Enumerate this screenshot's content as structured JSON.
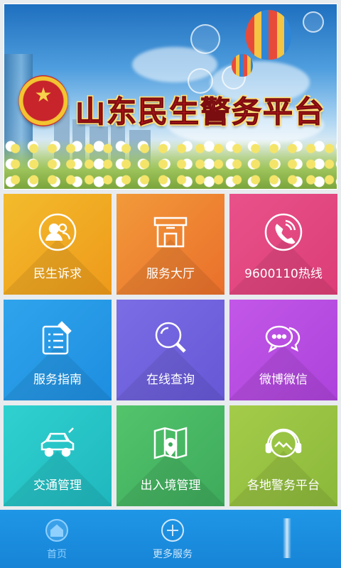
{
  "banner": {
    "title": "山东民生警务平台"
  },
  "tiles": [
    {
      "label": "民生诉求",
      "icon": "people-icon",
      "color_from": "#f3bb2c",
      "color_to": "#ee9a1b"
    },
    {
      "label": "服务大厅",
      "icon": "storefront-icon",
      "color_from": "#f29a3a",
      "color_to": "#ea6f2b"
    },
    {
      "label": "9600110热线",
      "icon": "phone-icon",
      "color_from": "#e9518a",
      "color_to": "#dc3e76"
    },
    {
      "label": "服务指南",
      "icon": "checklist-icon",
      "color_from": "#2fa4ec",
      "color_to": "#1e8ee0"
    },
    {
      "label": "在线查询",
      "icon": "search-icon",
      "color_from": "#7b6de4",
      "color_to": "#6658d6"
    },
    {
      "label": "微博微信",
      "icon": "chat-icon",
      "color_from": "#c257e8",
      "color_to": "#ad43db"
    },
    {
      "label": "交通管理",
      "icon": "car-icon",
      "color_from": "#2fd1cf",
      "color_to": "#1fb7be"
    },
    {
      "label": "出入境管理",
      "icon": "map-pin-icon",
      "color_from": "#53c46c",
      "color_to": "#3daa5b"
    },
    {
      "label": "各地警务平台",
      "icon": "headset-icon",
      "color_from": "#a4cc4a",
      "color_to": "#8bb83a"
    }
  ],
  "nav": {
    "items": [
      {
        "label": "首页",
        "icon": "home-icon",
        "active": true
      },
      {
        "label": "更多服务",
        "icon": "plus-circle-icon",
        "active": false
      }
    ]
  }
}
